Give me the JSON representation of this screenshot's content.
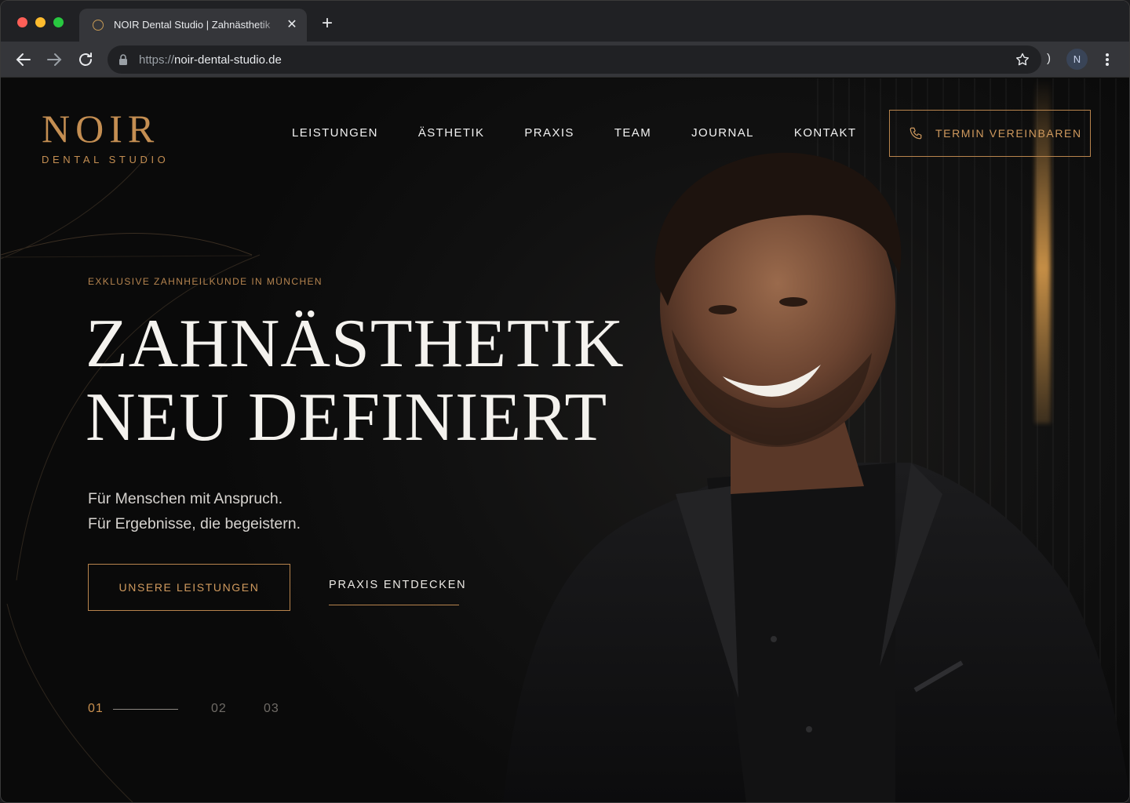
{
  "browser": {
    "tab_title": "NOIR Dental Studio | Zahnästhetik",
    "new_tab": "+",
    "close": "✕",
    "url_scheme": "https://",
    "url_host": "noir-dental-studio.de",
    "profile_initial": "N",
    "extension_glyph": ")"
  },
  "header": {
    "logo_word": "NOIR",
    "logo_sub": "DENTAL STUDIO",
    "nav": [
      "LEISTUNGEN",
      "ÄSTHETIK",
      "PRAXIS",
      "TEAM",
      "JOURNAL",
      "KONTAKT"
    ],
    "cta": "TERMIN VEREINBAREN"
  },
  "hero": {
    "eyebrow": "EXKLUSIVE ZAHNHEILKUNDE IN MÜNCHEN",
    "headline_line1": "ZAHNÄSTHETIK",
    "headline_line2": "NEU DEFINIERT",
    "sub_line1": "Für Menschen mit Anspruch.",
    "sub_line2": "Für Ergebnisse, die begeistern.",
    "primary_button": "UNSERE LEISTUNGEN",
    "secondary_link": "PRAXIS ENTDECKEN",
    "slides": [
      "01",
      "02",
      "03"
    ],
    "active_slide": "01"
  },
  "colors": {
    "accent_gold": "#c48e52",
    "background": "#0b0b0b",
    "text": "#f4f2ee"
  },
  "icons": [
    "back-arrow-icon",
    "forward-arrow-icon",
    "reload-icon",
    "lock-icon",
    "star-icon",
    "kebab-menu-icon",
    "phone-icon"
  ]
}
